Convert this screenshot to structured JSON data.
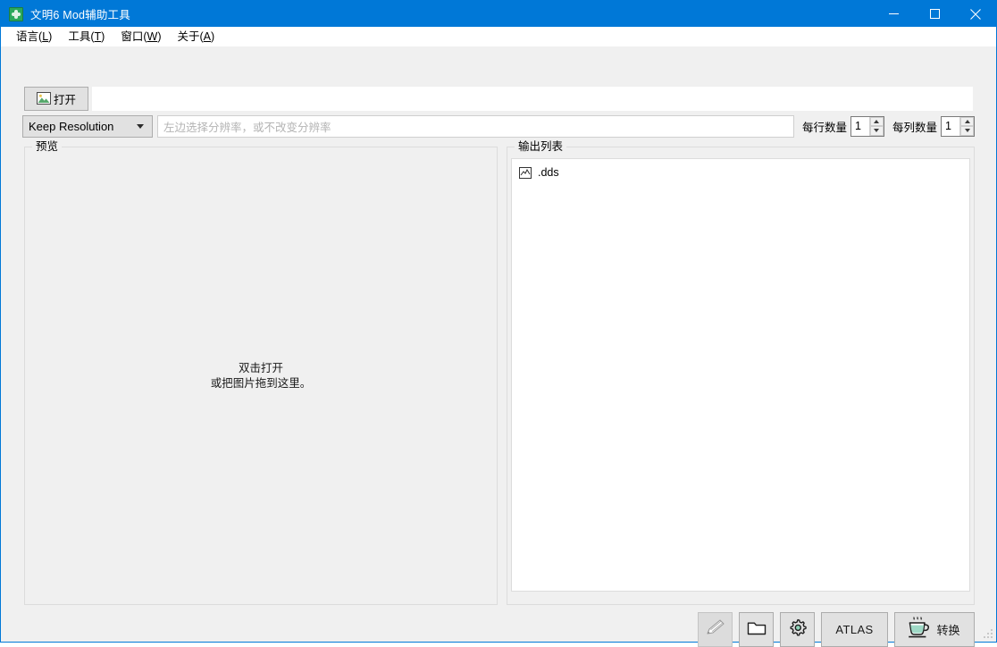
{
  "window": {
    "title": "文明6 Mod辅助工具",
    "icon": "app-green-icon",
    "controls": {
      "minimize": "minimize-icon",
      "maximize": "maximize-icon",
      "close": "close-icon"
    }
  },
  "menubar": {
    "items": [
      {
        "label": "语言",
        "accel": "L"
      },
      {
        "label": "工具",
        "accel": "T"
      },
      {
        "label": "窗口",
        "accel": "W"
      },
      {
        "label": "关于",
        "accel": "A"
      }
    ]
  },
  "toolbar": {
    "open_button": {
      "label": "打开",
      "icon": "picture-icon"
    },
    "path_value": "",
    "resolution_combo": {
      "value": "Keep Resolution"
    },
    "resolution_hint": "左边选择分辨率，或不改变分辨率",
    "rows": {
      "label": "每行数量",
      "value": "1"
    },
    "cols": {
      "label": "每列数量",
      "value": "1"
    }
  },
  "preview": {
    "group_label": "预览",
    "placeholder_line1": "双击打开",
    "placeholder_line2": "或把图片拖到这里。"
  },
  "output": {
    "group_label": "输出列表",
    "items": [
      {
        "label": ".dds",
        "icon": "image-file-icon"
      }
    ]
  },
  "actions": {
    "edit": {
      "label": "",
      "icon": "pencil-icon",
      "enabled": false
    },
    "folder": {
      "label": "",
      "icon": "folder-icon",
      "enabled": true
    },
    "settings": {
      "label": "",
      "icon": "gear-icon",
      "enabled": true
    },
    "atlas": {
      "label": "ATLAS",
      "enabled": true
    },
    "convert": {
      "label": "转换",
      "icon": "coffee-cup-icon",
      "enabled": true
    }
  },
  "colors": {
    "titlebar": "#0078d7",
    "window_bg": "#f0f0f0",
    "button_face": "#e1e1e1",
    "accent_green": "#2aa95b",
    "cup_liquid": "#9fd9c6"
  }
}
